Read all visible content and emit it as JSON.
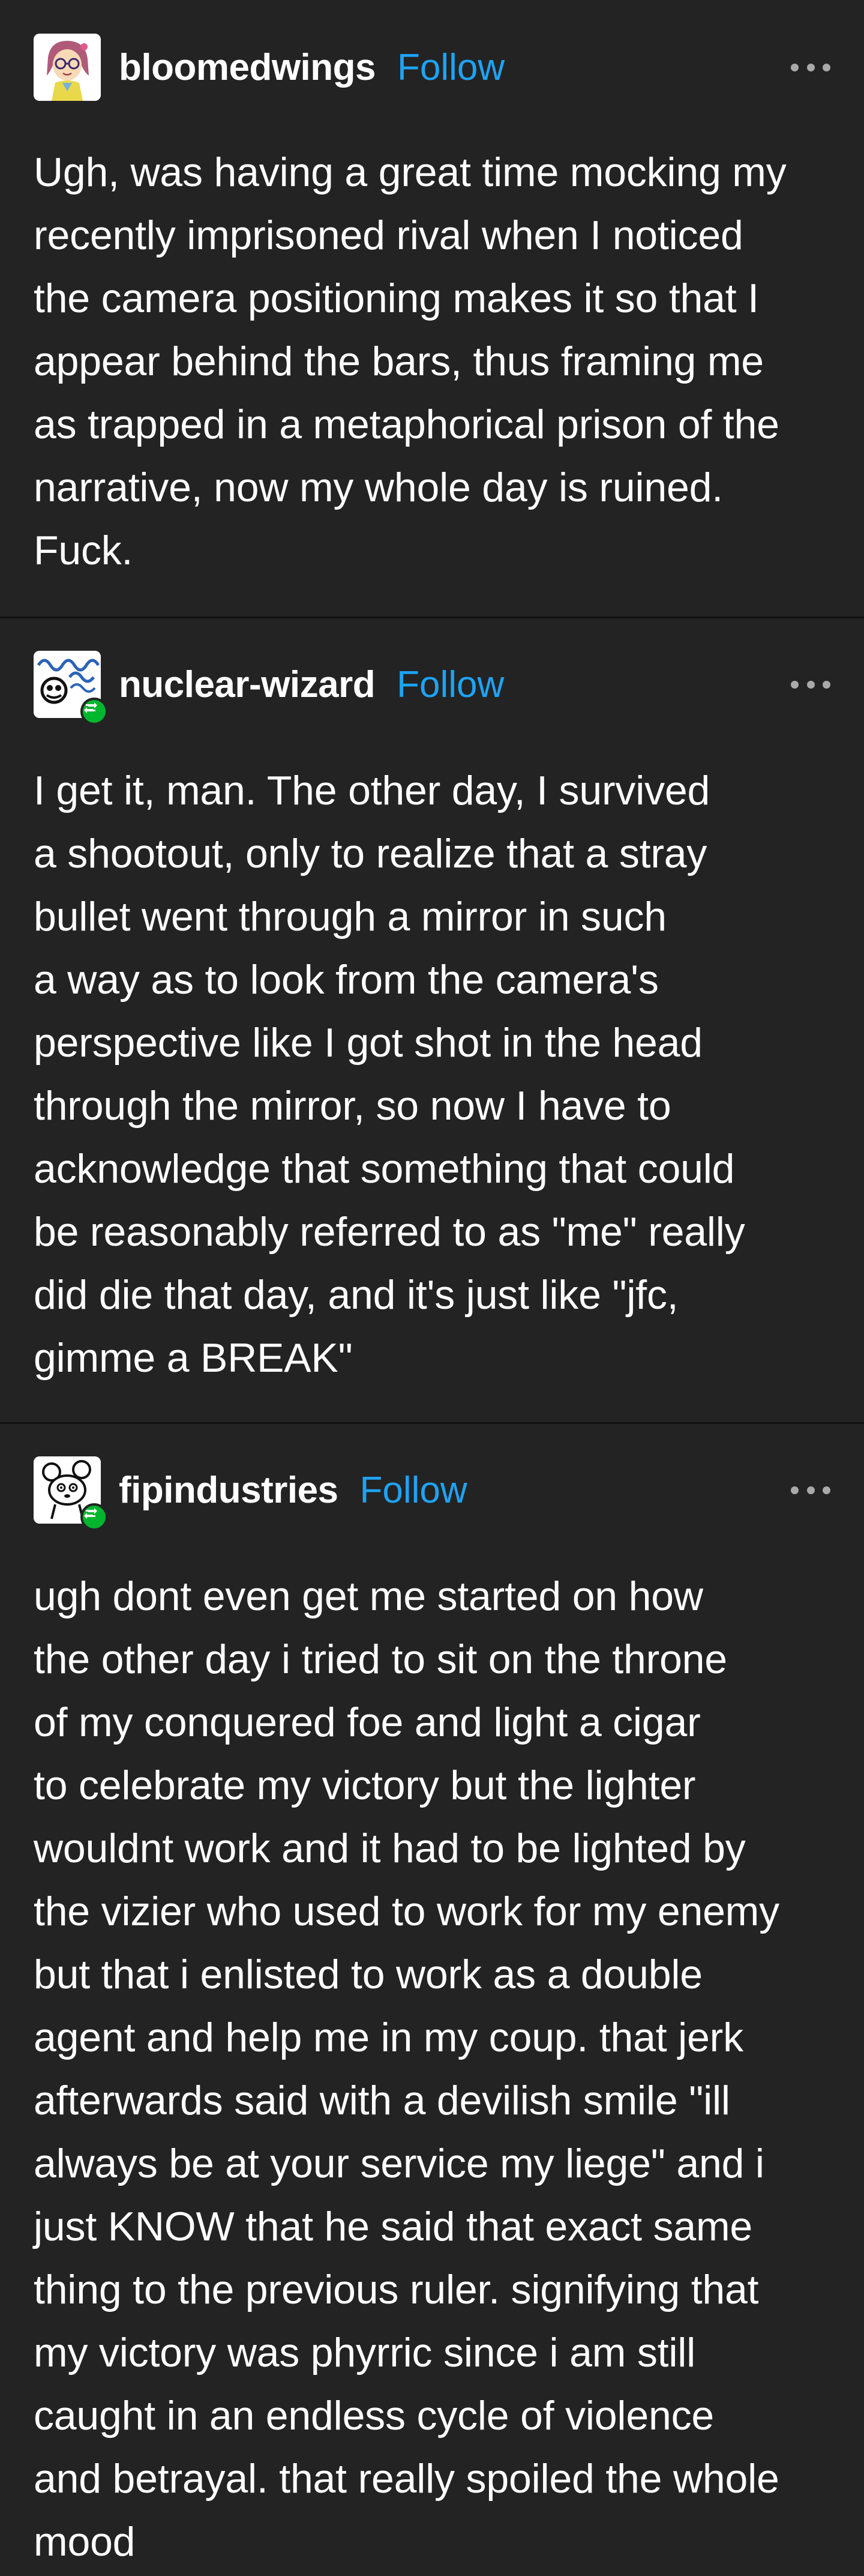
{
  "posts": [
    {
      "username": "bloomedwings",
      "follow_label": "Follow",
      "avatar_icon": "cartoon-girl-glasses-avatar",
      "reblogged": false,
      "body": "Ugh, was having a great time mocking my\nrecently imprisoned rival when I noticed\nthe camera positioning makes it so that I\nappear behind the bars, thus framing me\nas trapped in a metaphorical prison of the\nnarrative, now my whole day is ruined.\nFuck."
    },
    {
      "username": "nuclear-wizard",
      "follow_label": "Follow",
      "avatar_icon": "wave-doodle-avatar",
      "reblogged": true,
      "body": "I get it, man. The other day, I survived\na shootout, only to realize that a stray\nbullet went through a mirror in such\na way as to look from the camera's\nperspective like I got shot in the head\nthrough the mirror, so now I have to\nacknowledge that something that could\nbe reasonably referred to as \"me\" really\ndid die that day, and it's just like \"jfc,\ngimme a BREAK\""
    },
    {
      "username": "fipindustries",
      "follow_label": "Follow",
      "avatar_icon": "cartoon-creature-avatar",
      "reblogged": true,
      "body": "ugh dont even get me started on how\nthe other day i tried to sit on the throne\nof my conquered foe and light a cigar\nto celebrate my victory but the lighter\nwouldnt work and it had to be lighted by\nthe vizier who used to work for my enemy\nbut that i enlisted to work as a double\nagent and help me in my coup. that jerk\nafterwards said with a devilish smile \"ill\nalways be at your service my liege\" and i\njust KNOW that he said that exact same\nthing to the previous ruler. signifying that\nmy victory was phyrric since i am still\ncaught in an endless cycle of violence\nand betrayal. that really spoiled the whole\nmood"
    }
  ],
  "colors": {
    "background": "#232323",
    "follow": "#1ea3f5",
    "text": "#ffffff",
    "reblog_badge": "#00b62f",
    "menu_dots": "#a9a9a9"
  }
}
